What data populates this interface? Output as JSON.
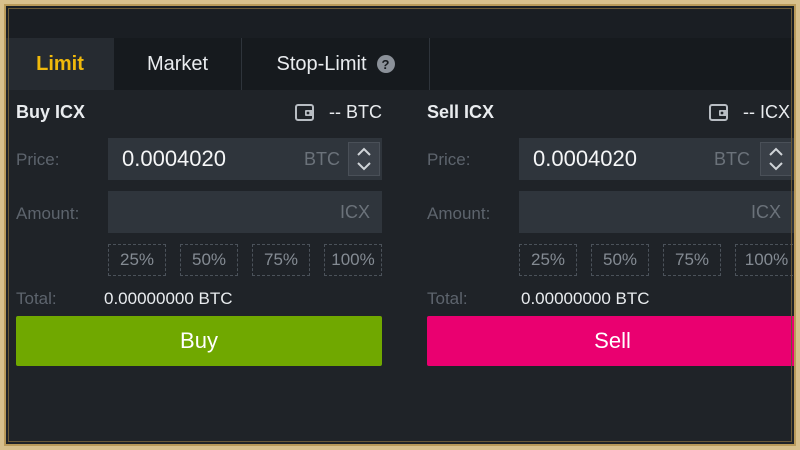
{
  "tabs": [
    {
      "label": "Limit"
    },
    {
      "label": "Market"
    },
    {
      "label": "Stop-Limit"
    }
  ],
  "help_glyph": "?",
  "buy": {
    "title": "Buy ICX",
    "wallet_balance": "-- BTC",
    "price_label": "Price:",
    "price_value": "0.0004020",
    "price_unit": "BTC",
    "amount_label": "Amount:",
    "amount_value": "",
    "amount_unit": "ICX",
    "percentages": [
      "25%",
      "50%",
      "75%",
      "100%"
    ],
    "total_label": "Total:",
    "total_value": "0.00000000 BTC",
    "button_label": "Buy"
  },
  "sell": {
    "title": "Sell ICX",
    "wallet_balance": "-- ICX",
    "price_label": "Price:",
    "price_value": "0.0004020",
    "price_unit": "BTC",
    "amount_label": "Amount:",
    "amount_value": "",
    "amount_unit": "ICX",
    "percentages": [
      "25%",
      "50%",
      "75%",
      "100%"
    ],
    "total_label": "Total:",
    "total_value": "0.00000000 BTC",
    "button_label": "Sell"
  },
  "colors": {
    "accent": "#f0b90b",
    "buy": "#70a800",
    "sell": "#ea0070",
    "background": "#1f2328",
    "input_bg": "#2f353c"
  },
  "icons": {
    "wallet": "wallet-icon",
    "help": "question-circle-icon",
    "stepper": "chevron-up-down-icon"
  }
}
